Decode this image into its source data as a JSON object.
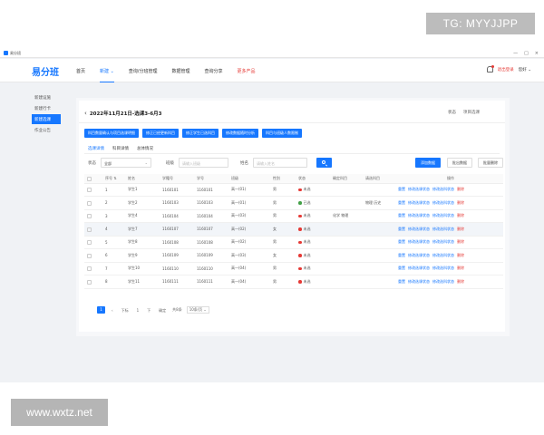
{
  "watermarks": {
    "top": "TG: MYYJJPP",
    "bottom": "www.wxtz.net"
  },
  "window": {
    "title": "易分班",
    "controls": [
      "—",
      "□",
      "×"
    ]
  },
  "header": {
    "logo": "易分班",
    "nav": [
      {
        "label": "首页"
      },
      {
        "label": "新建 ⌄"
      },
      {
        "label": "查询/分班管理"
      },
      {
        "label": "数据管理"
      },
      {
        "label": "查询分享"
      },
      {
        "label": "更多产品"
      }
    ],
    "logout": "退出登录",
    "user": "您好 ⌄"
  },
  "sidebar": {
    "items": [
      {
        "label": "新建设施"
      },
      {
        "label": "新建行卡"
      },
      {
        "label": "新建选课"
      },
      {
        "label": "作业公告"
      }
    ]
  },
  "page": {
    "title": "2022年11月21日-选课3-6月3",
    "status_label": "状态",
    "status_value": "项目选课"
  },
  "toolbar_buttons": [
    "科目数量确认与项目选课明细",
    "修正已经更新科目",
    "修正学生已选科目",
    "修改数据随时分析",
    "科目与班级人数限制"
  ],
  "tabs": [
    "选课详情",
    "科目详情",
    "总体情况"
  ],
  "filters": {
    "status_label": "状态",
    "status_value": "全部",
    "class_label": "班级",
    "class_placeholder": "请输入班级",
    "name_label": "姓名",
    "name_placeholder": "请输入姓名"
  },
  "actions": {
    "add": "添加数据",
    "export": "批出数据",
    "batch": "批量删除"
  },
  "table": {
    "headers": [
      "",
      "序号 ⇅",
      "姓名",
      "学籍号",
      "学号",
      "班级",
      "性别",
      "状态",
      "确定科目",
      "请选科目",
      "操作"
    ],
    "rows": [
      {
        "no": "1",
        "name": "学生1",
        "sid": "1160101",
        "num": "1160101",
        "cls": "高一(01)",
        "sex": "男",
        "status": "未选",
        "status_color": "#e53935",
        "sure": "",
        "pick": ""
      },
      {
        "no": "2",
        "name": "学生2",
        "sid": "1160103",
        "num": "1160103",
        "cls": "高一(01)",
        "sex": "男",
        "status": "已选",
        "status_color": "#43a047",
        "sure": "",
        "pick": "物理 历史"
      },
      {
        "no": "3",
        "name": "学生4",
        "sid": "1160104",
        "num": "1160104",
        "cls": "高一(03)",
        "sex": "男",
        "status": "未选",
        "status_color": "#e53935",
        "sure": "化学 物理",
        "pick": ""
      },
      {
        "no": "4",
        "name": "学生7",
        "sid": "1160107",
        "num": "1160107",
        "cls": "高一(02)",
        "sex": "女",
        "status": "未选",
        "status_color": "#e53935",
        "sure": "",
        "pick": ""
      },
      {
        "no": "5",
        "name": "学生8",
        "sid": "1160108",
        "num": "1160108",
        "cls": "高一(02)",
        "sex": "男",
        "status": "未选",
        "status_color": "#e53935",
        "sure": "",
        "pick": ""
      },
      {
        "no": "6",
        "name": "学生9",
        "sid": "1160109",
        "num": "1160109",
        "cls": "高一(03)",
        "sex": "女",
        "status": "未选",
        "status_color": "#e53935",
        "sure": "",
        "pick": ""
      },
      {
        "no": "7",
        "name": "学生10",
        "sid": "1160110",
        "num": "1160110",
        "cls": "高一(04)",
        "sex": "男",
        "status": "未选",
        "status_color": "#e53935",
        "sure": "",
        "pick": ""
      },
      {
        "no": "8",
        "name": "学生11",
        "sid": "1160111",
        "num": "1160111",
        "cls": "高一(04)",
        "sex": "男",
        "status": "未选",
        "status_color": "#e53935",
        "sure": "",
        "pick": ""
      }
    ],
    "ops": [
      "重置",
      "修改选课状态",
      "修改选科状态",
      "删除"
    ]
  },
  "pager": {
    "prev": "‹",
    "current": "1",
    "prev_label": "下标",
    "p1": "1",
    "next": "下",
    "jump": "确定",
    "total": "共8条",
    "page_size": "10条/页 ⌄"
  }
}
